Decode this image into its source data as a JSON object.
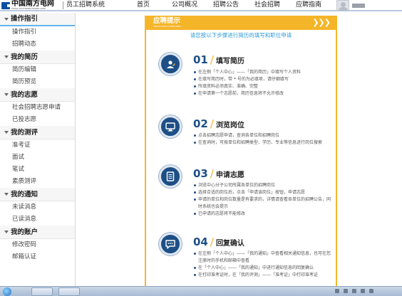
{
  "header": {
    "logo_cn": "中国南方电网",
    "logo_en": "CHINA SOUTHERN POWER GRID",
    "system_name": "员工招聘系统",
    "nav": [
      "首页",
      "公司概况",
      "招聘公告",
      "社会招聘",
      "应聘指南"
    ]
  },
  "sidebar": {
    "groups": [
      {
        "title": "操作指引",
        "active": true,
        "items": [
          "操作指引",
          "招聘动态"
        ]
      },
      {
        "title": "我的简历",
        "active": false,
        "items": [
          "简历编辑",
          "简历预览"
        ]
      },
      {
        "title": "我的志愿",
        "active": false,
        "items": [
          "社会招聘志愿申请",
          "已投志愿"
        ]
      },
      {
        "title": "我的测评",
        "active": false,
        "items": [
          "准考证",
          "面试",
          "笔试",
          "素质测评"
        ]
      },
      {
        "title": "我的通知",
        "active": false,
        "items": [
          "未读消息",
          "已读消息"
        ]
      },
      {
        "title": "我的账户",
        "active": false,
        "items": [
          "修改密码",
          "邮箱认证"
        ]
      }
    ]
  },
  "guide": {
    "title": "应聘提示",
    "title_en": "APPLICATION GUIDELINES",
    "arrows": "❯❯❯",
    "subtitle": "请您按以下步骤进行简历的填写和职位申请",
    "accent_color": "#f4b529",
    "primary_color": "#1d4f86",
    "steps": [
      {
        "num": "01",
        "title": "填写简历",
        "icon": "resume-edit-icon",
        "bullets": [
          "在左侧「个人中心」——「我的简历」中填写个人资料",
          "在填写简历时，带 * 号的为必填项，请仔细填写",
          "所填资料必须真实、准确、完整",
          "在申请第一个志愿前，简历信息将不允许修改"
        ]
      },
      {
        "num": "02",
        "title": "浏览岗位",
        "icon": "monitor-icon",
        "bullets": [
          "点击招聘志愿申请，查询各单位和招聘岗位",
          "在查询时，可按单位和招聘类型、学历、专业等信息进行岗位搜索"
        ]
      },
      {
        "num": "03",
        "title": "申请志愿",
        "icon": "document-icon",
        "bullets": [
          "浏览中心分子公司所属各单位的招聘岗位",
          "选择合适的岗位后，点击「申请该岗位」按钮，申请志愿",
          "申请的单位和岗位数量是有要求的，详情请查看各单位的招聘公告，同时系统也会提示",
          "已申请的志愿将不能修改"
        ]
      },
      {
        "num": "04",
        "title": "回复确认",
        "icon": "message-icon",
        "bullets": [
          "在左侧「个人中心」——「我的通知」中查看相关通知信息，也可在您注册时的手机和邮箱中查看",
          "在「个人中心」——「我的通知」中进行通知信息的回复确认",
          "在打印准考证时，在「我的评测」——「准考证」中打印准考证"
        ]
      }
    ]
  }
}
